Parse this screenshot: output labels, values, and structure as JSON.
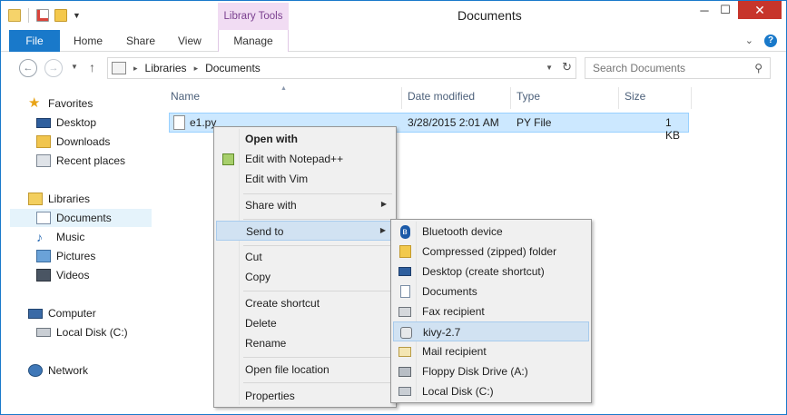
{
  "window": {
    "title": "Documents",
    "context_tab_header": "Library Tools",
    "controls": {
      "minimize": "─",
      "maximize": "☐",
      "close": "✕"
    }
  },
  "ribbon": {
    "tabs": [
      {
        "label": "File"
      },
      {
        "label": "Home"
      },
      {
        "label": "Share"
      },
      {
        "label": "View"
      },
      {
        "label": "Manage"
      }
    ],
    "collapse_icon": "⌄",
    "help_icon": "?"
  },
  "address": {
    "crumbs": [
      "Libraries",
      "Documents"
    ],
    "separator": "▸",
    "search_placeholder": "Search Documents",
    "search_icon": "⚲"
  },
  "nav": {
    "back": "←",
    "forward": "→",
    "dropdown": "▼",
    "up": "↑"
  },
  "navpane": {
    "groups": [
      {
        "label": "Favorites",
        "icon": "star-icon"
      },
      {
        "label": "Desktop",
        "icon": "desktop-icon"
      },
      {
        "label": "Downloads",
        "icon": "downloads-icon"
      },
      {
        "label": "Recent places",
        "icon": "recent-places-icon"
      },
      {
        "label": "Libraries",
        "icon": "libraries-icon"
      },
      {
        "label": "Documents",
        "icon": "documents-icon"
      },
      {
        "label": "Music",
        "icon": "music-icon"
      },
      {
        "label": "Pictures",
        "icon": "pictures-icon"
      },
      {
        "label": "Videos",
        "icon": "videos-icon"
      },
      {
        "label": "Computer",
        "icon": "computer-icon"
      },
      {
        "label": "Local Disk (C:)",
        "icon": "local-disk-icon"
      },
      {
        "label": "Network",
        "icon": "network-icon"
      }
    ]
  },
  "filelist": {
    "columns": [
      "Name",
      "Date modified",
      "Type",
      "Size"
    ],
    "sort_indicator": "▲",
    "rows": [
      {
        "name": "e1.py",
        "date": "3/28/2015 2:01 AM",
        "type": "PY File",
        "size": "1 KB"
      }
    ]
  },
  "context_menu": {
    "items": [
      {
        "label": "Open with"
      },
      {
        "label": "Edit with Notepad++"
      },
      {
        "label": "Edit with Vim"
      },
      {
        "label": "Share with"
      },
      {
        "label": "Send to"
      },
      {
        "label": "Cut"
      },
      {
        "label": "Copy"
      },
      {
        "label": "Create shortcut"
      },
      {
        "label": "Delete"
      },
      {
        "label": "Rename"
      },
      {
        "label": "Open file location"
      },
      {
        "label": "Properties"
      }
    ],
    "submenu_arrow": "▶"
  },
  "send_to_menu": {
    "items": [
      {
        "label": "Bluetooth device"
      },
      {
        "label": "Compressed (zipped) folder"
      },
      {
        "label": "Desktop (create shortcut)"
      },
      {
        "label": "Documents"
      },
      {
        "label": "Fax recipient"
      },
      {
        "label": "kivy-2.7"
      },
      {
        "label": "Mail recipient"
      },
      {
        "label": "Floppy Disk Drive (A:)"
      },
      {
        "label": "Local Disk (C:)"
      }
    ]
  }
}
